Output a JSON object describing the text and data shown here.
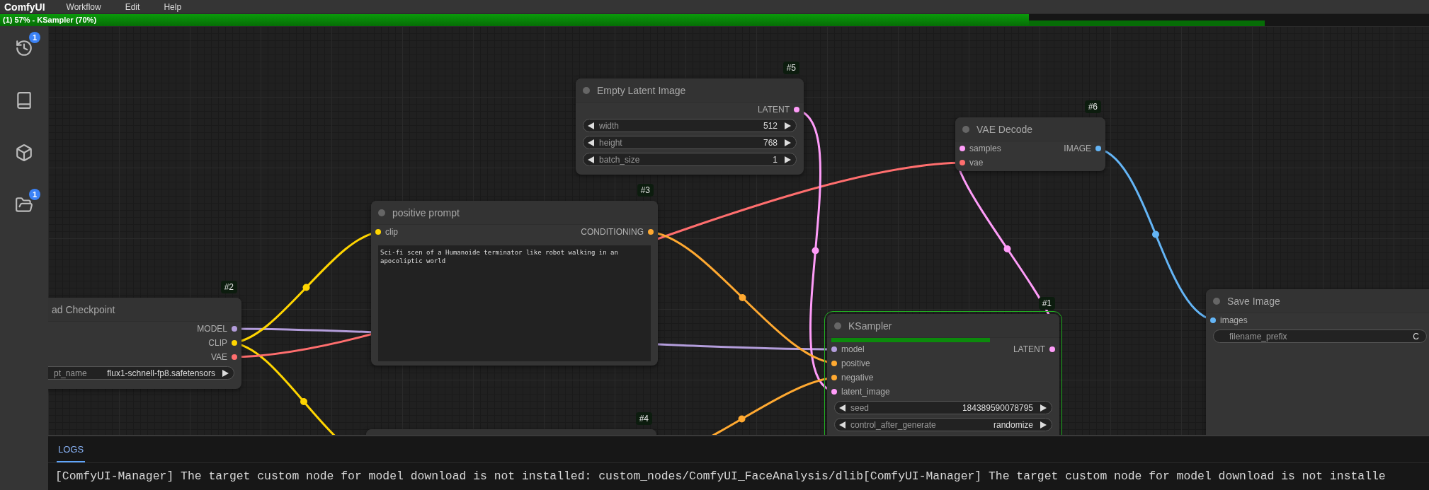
{
  "menu": {
    "brand": "ComfyUI",
    "items": [
      "Workflow",
      "Edit",
      "Help"
    ]
  },
  "progress": {
    "text": "(1) 57% - KSampler (70%)",
    "level": 0.72,
    "node": {
      "level": 0.885
    }
  },
  "sidebar": {
    "items": [
      {
        "kind": "history",
        "badge": "1"
      },
      {
        "kind": "book"
      },
      {
        "kind": "cube"
      },
      {
        "kind": "folder",
        "badge": "1"
      }
    ]
  },
  "nodes": [
    {
      "badge": "#5",
      "title": "Empty Latent Image",
      "running": false,
      "outputs": [
        {
          "label": "LATENT",
          "color": "#ff9cf9"
        }
      ],
      "widgets": [
        {
          "kind": "stepper",
          "label": "width",
          "value": "512"
        },
        {
          "kind": "stepper",
          "label": "height",
          "value": "768"
        },
        {
          "kind": "stepper",
          "label": "batch_size",
          "value": "1"
        }
      ]
    },
    {
      "badge": "#6",
      "title": "VAE Decode",
      "running": false,
      "inputs": [
        {
          "label": "samples",
          "color": "#ff9cf9"
        },
        {
          "label": "vae",
          "color": "#ff6e6e"
        }
      ],
      "outputs": [
        {
          "label": "IMAGE",
          "color": "#64b5f6"
        }
      ]
    },
    {
      "badge": "#3",
      "title": "positive prompt",
      "running": false,
      "inputs": [
        {
          "label": "clip",
          "color": "#ffd500"
        }
      ],
      "outputs": [
        {
          "label": "CONDITIONING",
          "color": "#ffa931"
        }
      ],
      "widgets": [
        {
          "kind": "textarea",
          "value": "Sci-fi scen of a Humanoide terminator like robot walking in an apocoliptic world"
        }
      ]
    },
    {
      "title": "Save Image",
      "running": false,
      "inputs": [
        {
          "label": "images",
          "color": "#64b5f6"
        }
      ],
      "widgets": [
        {
          "kind": "text",
          "label": "filename_prefix",
          "value": "C"
        }
      ]
    },
    {
      "badge": "#2",
      "title": "ad Checkpoint",
      "running": false,
      "outputs": [
        {
          "label": "MODEL",
          "color": "#b39ddb"
        },
        {
          "label": "CLIP",
          "color": "#ffd500"
        },
        {
          "label": "VAE",
          "color": "#ff6e6e"
        }
      ],
      "widgets": [
        {
          "kind": "select",
          "label": "pt_name",
          "value": "flux1-schnell-fp8.safetensors"
        }
      ]
    },
    {
      "badge": "#1",
      "title": "KSampler",
      "running": true,
      "level": 0.71,
      "inputs": [
        {
          "label": "model",
          "color": "#b39ddb"
        },
        {
          "label": "positive",
          "color": "#ffa931"
        },
        {
          "label": "negative",
          "color": "#ffa931"
        },
        {
          "label": "latent_image",
          "color": "#ff9cf9"
        }
      ],
      "outputs": [
        {
          "label": "LATENT",
          "color": "#ff9cf9"
        }
      ],
      "widgets": [
        {
          "kind": "stepper",
          "label": "seed",
          "value": "184389590078795"
        },
        {
          "kind": "stepper",
          "label": "control_after_generate",
          "value": "randomize"
        }
      ]
    },
    {
      "badge": "#4",
      "running": false
    }
  ],
  "logs": {
    "tabs": [
      {
        "label": "LOGS",
        "selected": true
      }
    ],
    "lines": [
      "[ComfyUI-Manager] The target custom node for model download is not installed: custom_nodes/ComfyUI_FaceAnalysis/dlib[ComfyUI-Manager] The target custom node for model download is not installe"
    ]
  }
}
